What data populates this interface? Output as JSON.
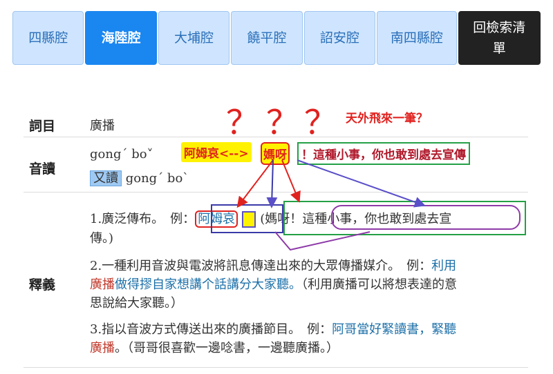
{
  "tabs": [
    {
      "label": "四縣腔"
    },
    {
      "label": "海陸腔"
    },
    {
      "label": "大埔腔"
    },
    {
      "label": "饒平腔"
    },
    {
      "label": "詔安腔"
    },
    {
      "label": "南四縣腔"
    },
    {
      "label": "回檢索清單"
    }
  ],
  "entry": {
    "term_label": "詞目",
    "term": "廣播",
    "pron_label": "音讀",
    "pron": "gong´ bo˅",
    "alt_label": "又讀",
    "alt_pron": "gong´ bo`",
    "def_label": "釋義"
  },
  "definitions": [
    {
      "text": "1.廣泛傳布。　例：",
      "ex_a": "阿姆哀",
      "ex_b": "(媽呀！這種小事，你也敢到處去宣",
      "tail": "傳。)"
    },
    {
      "line1": "2.一種利用音波與電波將訊息傳達出來的大眾傳播媒介。　例：",
      "ex1": "利用",
      "kw": "廣播",
      "ex2": "做得摎自家想講个話講分大家聽。",
      "gloss": "（利用廣播可以將想表達的意",
      "gloss2": "思說給大家聽。）"
    },
    {
      "line1": "3.指以音波方式傳送出來的廣播節目。　例：",
      "ex1": "阿哥當好緊讀書，緊聽",
      "kw": "廣播",
      "gloss": "。（哥哥很喜歡一邊唸書，一邊聽廣播。）"
    }
  ],
  "annotations": {
    "q1": "？",
    "q2": "？",
    "q3": "？",
    "note": "天外飛來一筆？",
    "hl_a": "阿姆哀<-->",
    "hl_b": "媽呀",
    "hl_c": "！這種小事，你也敢到處去宣傳"
  }
}
